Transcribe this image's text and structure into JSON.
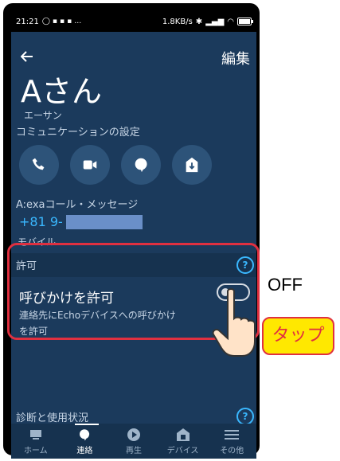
{
  "status_bar": {
    "time": "21:21",
    "net_speed": "1.8KB/s",
    "battery_percent": 100
  },
  "header": {
    "back_icon": "arrow-left-icon",
    "edit_label": "編集"
  },
  "contact": {
    "name": "Aさん",
    "kana": "エーサン",
    "communication_settings_label": "コミュニケーションの設定",
    "action_icons": [
      "phone-icon",
      "video-icon",
      "message-icon",
      "drop-in-icon"
    ],
    "alexa_call_label": "A:exaコール・メッセージ",
    "phone_number_prefix": "+81 9-",
    "phone_type": "モバイル"
  },
  "permissions": {
    "title": "許可",
    "call_permission_title": "呼びかけを許可",
    "call_permission_desc": "連絡先にEchoデバイスへの呼びかけを許可",
    "toggle_state": "off"
  },
  "diagnostics": {
    "title": "診断と使用状況"
  },
  "bottom_nav": {
    "items": [
      {
        "label": "ホーム",
        "icon": "home-icon"
      },
      {
        "label": "連絡",
        "icon": "chat-icon",
        "active": true
      },
      {
        "label": "再生",
        "icon": "play-icon"
      },
      {
        "label": "デバイス",
        "icon": "device-icon"
      },
      {
        "label": "その他",
        "icon": "menu-icon"
      }
    ]
  },
  "annotations": {
    "off_label": "OFF",
    "tap_label": "タップ"
  },
  "colors": {
    "background": "#1b3a5c",
    "accent": "#3ab8ff",
    "highlight": "#e03040",
    "tap_bg": "#ffe800"
  }
}
